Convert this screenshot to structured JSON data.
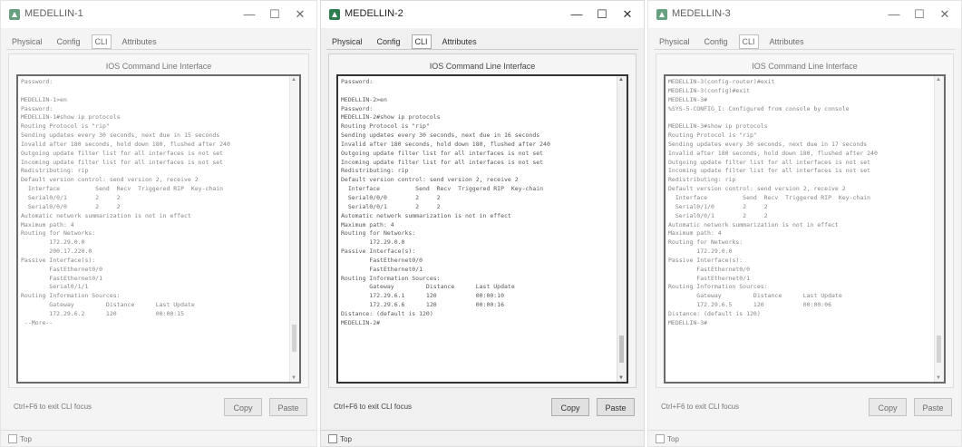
{
  "windows": [
    {
      "title": "MEDELLIN-1",
      "tabs": [
        "Physical",
        "Config",
        "CLI",
        "Attributes"
      ],
      "active_tab": "CLI",
      "heading": "IOS Command Line Interface",
      "lines": [
        "Password:",
        "",
        "MEDELLIN-1>en",
        "Password:",
        "MEDELLIN-1#show ip protocols",
        "Routing Protocol is \"rip\"",
        "Sending updates every 30 seconds, next due in 15 seconds",
        "Invalid after 180 seconds, hold down 180, flushed after 240",
        "Outgoing update filter list for all interfaces is not set",
        "Incoming update filter list for all interfaces is not set",
        "Redistributing: rip",
        "Default version control: send version 2, receive 2",
        "  Interface          Send  Recv  Triggered RIP  Key-chain",
        "  Serial0/0/1        2     2",
        "  Serial0/0/0        2     2",
        "Automatic network summarization is not in effect",
        "Maximum path: 4",
        "Routing for Networks:",
        "        172.29.0.0",
        "        200.17.220.0",
        "Passive Interface(s):",
        "        FastEthernet0/0",
        "        FastEthernet0/1",
        "        Serial0/1/1",
        "Routing Information Sources:",
        "        Gateway         Distance      Last Update",
        "        172.29.6.2      120           00:00:15",
        " --More--"
      ],
      "footer_text": "Ctrl+F6 to exit CLI focus",
      "copy_label": "Copy",
      "paste_label": "Paste",
      "top_label": "Top",
      "scroll_pos": 0.92
    },
    {
      "title": "MEDELLIN-2",
      "tabs": [
        "Physical",
        "Config",
        "CLI",
        "Attributes"
      ],
      "active_tab": "CLI",
      "heading": "IOS Command Line Interface",
      "lines": [
        "Password:",
        "",
        "MEDELLIN-2>en",
        "Password:",
        "MEDELLIN-2#show ip protocols",
        "Routing Protocol is \"rip\"",
        "Sending updates every 30 seconds, next due in 16 seconds",
        "Invalid after 180 seconds, hold down 180, flushed after 240",
        "Outgoing update filter list for all interfaces is not set",
        "Incoming update filter list for all interfaces is not set",
        "Redistributing: rip",
        "Default version control: send version 2, receive 2",
        "  Interface          Send  Recv  Triggered RIP  Key-chain",
        "  Serial0/0/0        2     2",
        "  Serial0/0/1        2     2",
        "Automatic network summarization is not in effect",
        "Maximum path: 4",
        "Routing for Networks:",
        "        172.29.0.0",
        "Passive Interface(s):",
        "        FastEthernet0/0",
        "        FastEthernet0/1",
        "Routing Information Sources:",
        "        Gateway         Distance      Last Update",
        "        172.29.6.1      120           00:00:10",
        "        172.29.6.6      120           00:00:16",
        "Distance: (default is 120)",
        "MEDELLIN-2#"
      ],
      "footer_text": "Ctrl+F6 to exit CLI focus",
      "copy_label": "Copy",
      "paste_label": "Paste",
      "top_label": "Top",
      "scroll_pos": 0.96
    },
    {
      "title": "MEDELLIN-3",
      "tabs": [
        "Physical",
        "Config",
        "CLI",
        "Attributes"
      ],
      "active_tab": "CLI",
      "heading": "IOS Command Line Interface",
      "lines": [
        "MEDELLIN-3(config-router)#exit",
        "MEDELLIN-3(config)#exit",
        "MEDELLIN-3#",
        "%SYS-5-CONFIG_I: Configured from console by console",
        "",
        "MEDELLIN-3#show ip protocols",
        "Routing Protocol is \"rip\"",
        "Sending updates every 30 seconds, next due in 17 seconds",
        "Invalid after 180 seconds, hold down 180, flushed after 240",
        "Outgoing update filter list for all interfaces is not set",
        "Incoming update filter list for all interfaces is not set",
        "Redistributing: rip",
        "Default version control: send version 2, receive 2",
        "  Interface          Send  Recv  Triggered RIP  Key-chain",
        "  Serial0/1/0        2     2",
        "  Serial0/0/1        2     2",
        "Automatic network summarization is not in effect",
        "Maximum path: 4",
        "Routing for Networks:",
        "        172.29.0.0",
        "Passive Interface(s):",
        "        FastEthernet0/0",
        "        FastEthernet0/1",
        "Routing Information Sources:",
        "        Gateway         Distance      Last Update",
        "        172.29.6.5      120           00:00:06",
        "Distance: (default is 120)",
        "MEDELLIN-3#"
      ],
      "footer_text": "Ctrl+F6 to exit CLI focus",
      "copy_label": "Copy",
      "paste_label": "Paste",
      "top_label": "Top",
      "scroll_pos": 0.96
    }
  ],
  "icons": {
    "app": "packet-tracer-icon",
    "minimize": "minimize-icon",
    "maximize": "maximize-icon",
    "close": "close-icon",
    "scroll_up": "scroll-up-icon",
    "scroll_down": "scroll-down-icon"
  },
  "colors": {
    "terminal_border": "#333333",
    "terminal_text": "#555555",
    "window_bg": "#f0f0f0",
    "app_icon": "#2e7d4f"
  }
}
